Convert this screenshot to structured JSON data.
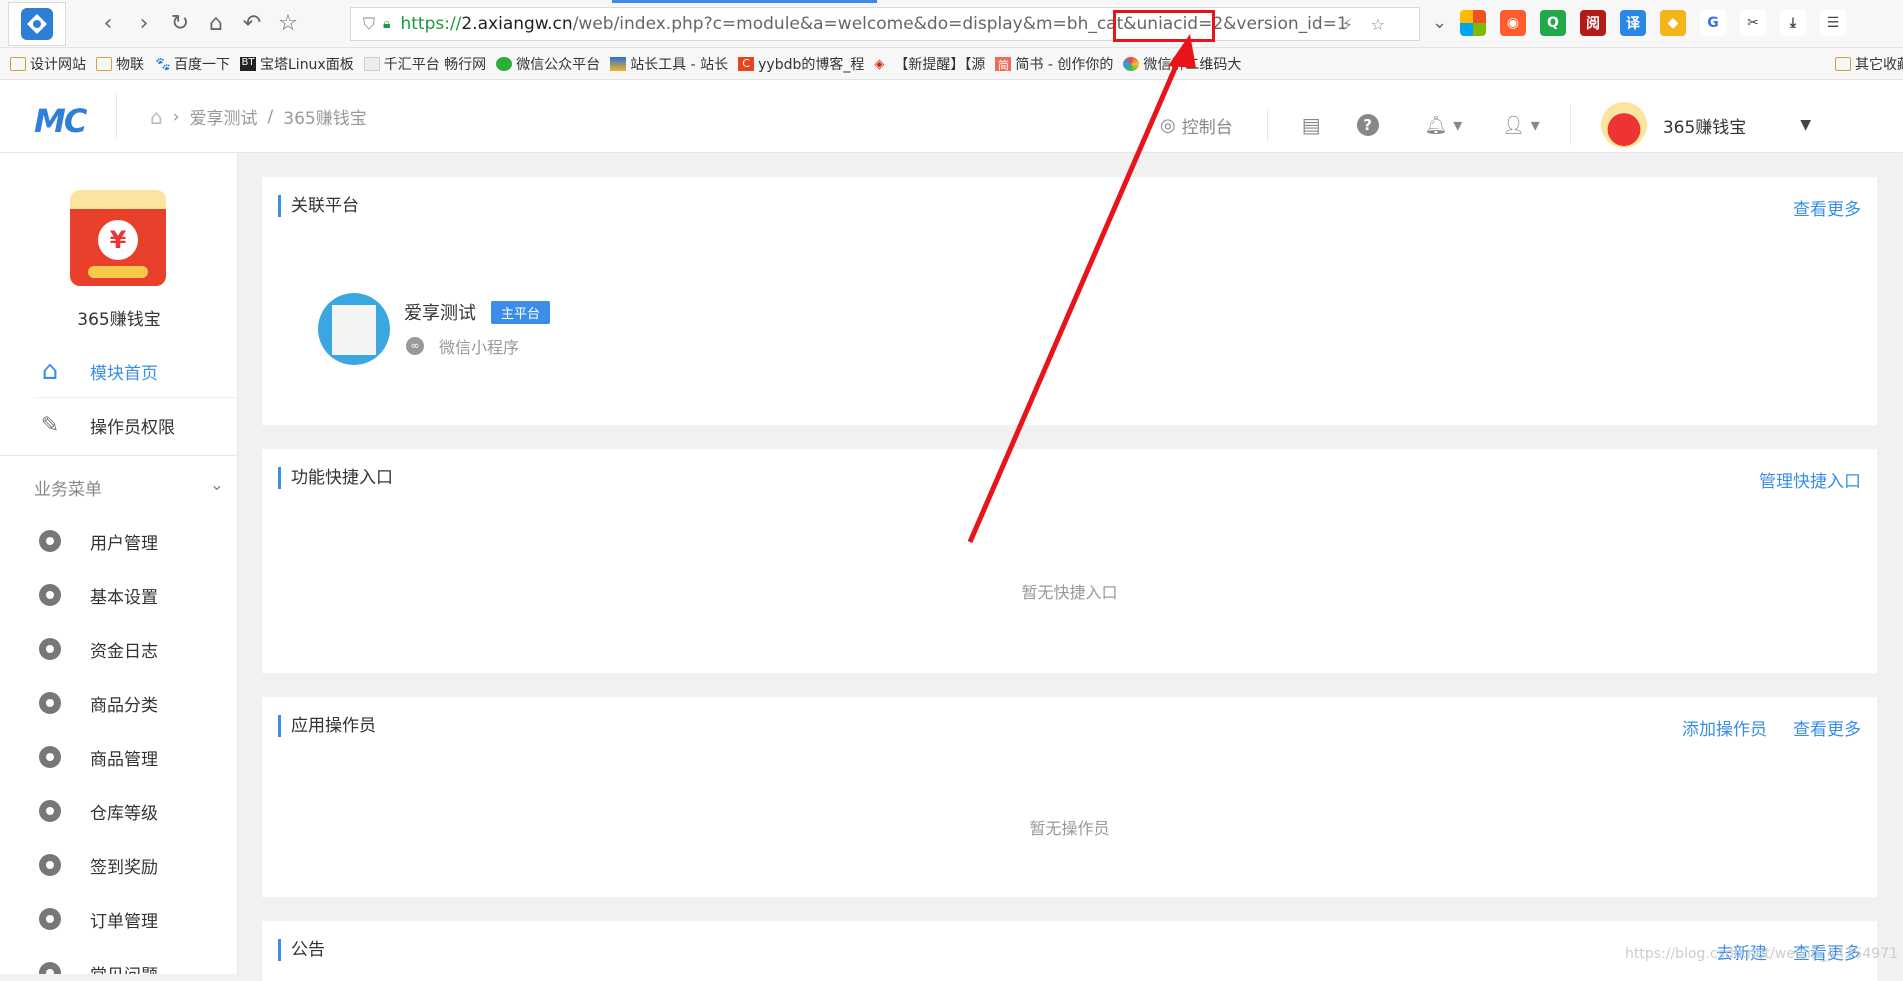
{
  "browser": {
    "url_prefix": "https://",
    "url_host": "2.axiangw.cn",
    "url_path": "/web/index.php?c=module&a=welcome&do=display&m=bh_cat&uniacid=2&version_id=1",
    "icons": [
      "back-icon",
      "forward-icon",
      "reload-icon",
      "home-icon",
      "undo-icon",
      "star-icon"
    ]
  },
  "bookmarks": [
    {
      "label": "设计网站",
      "icon": "folder-icon"
    },
    {
      "label": "物联",
      "icon": "folder-icon"
    },
    {
      "label": "百度一下",
      "icon": "baidu-icon"
    },
    {
      "label": "宝塔Linux面板",
      "icon": "bt-icon"
    },
    {
      "label": "千汇平台 畅行网",
      "icon": "site-icon"
    },
    {
      "label": "微信公众平台",
      "icon": "wechat-icon"
    },
    {
      "label": "站长工具 - 站长",
      "icon": "site-icon"
    },
    {
      "label": "yybdb的博客_程",
      "icon": "csdn-icon"
    },
    {
      "label": "【新提醒】【源",
      "icon": "site-icon"
    },
    {
      "label": "简书 - 创作你的",
      "icon": "jianshu-icon"
    },
    {
      "label": "微信群二维码大",
      "icon": "site-icon"
    }
  ],
  "bookmarks_right": "其它收藏",
  "header": {
    "logo": "MC",
    "breadcrumb_app": "爱享测试",
    "breadcrumb_sep": "/",
    "breadcrumb_module": "365赚钱宝",
    "console": "控制台",
    "account_name": "365赚钱宝"
  },
  "sidebar": {
    "app_name": "365赚钱宝",
    "top_items": [
      {
        "label": "模块首页",
        "active": true
      },
      {
        "label": "操作员权限",
        "active": false
      }
    ],
    "section_label": "业务菜单",
    "menu": [
      "用户管理",
      "基本设置",
      "资金日志",
      "商品分类",
      "商品管理",
      "仓库等级",
      "签到奖励",
      "订单管理",
      "常见问题"
    ]
  },
  "panels": {
    "platform": {
      "title": "关联平台",
      "more": "查看更多",
      "name": "爱享测试",
      "badge": "主平台",
      "type": "微信小程序"
    },
    "shortcut": {
      "title": "功能快捷入口",
      "manage": "管理快捷入口",
      "empty": "暂无快捷入口"
    },
    "operator": {
      "title": "应用操作员",
      "add": "添加操作员",
      "more": "查看更多",
      "empty": "暂无操作员"
    },
    "notice": {
      "title": "公告",
      "new": "去新建",
      "more": "查看更多"
    }
  },
  "watermark": "https://blog.csdn.net/weixin_44254971",
  "colors": {
    "accent": "#3b8ee8",
    "annotation": "#e8141a"
  }
}
